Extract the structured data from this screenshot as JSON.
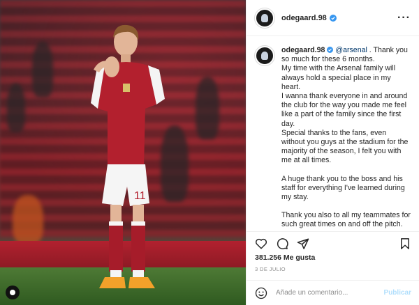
{
  "post": {
    "username": "odegaard.98",
    "likes": "381.256 Me gusta",
    "date": "3 DE JULIO"
  },
  "caption": {
    "username": "odegaard.98",
    "mention": "@arsenal",
    "p1": ". Thank you so much for these 6 months.",
    "p2": "My time with the Arsenal family will always hold a special place in my heart.",
    "p3": "I wanna thank everyone in and around the club for the way you made me feel like a part of the family since the first day.",
    "p4": "Special thanks to the fans, even without you guys at the stadium for the majority of the season, I felt you with me at all times.",
    "p5": "A huge thank you to the boss and his staff for everything I've learned during my stay.",
    "p6": "Thank you also to all my teammates for such great times on and off the pitch."
  },
  "comment": {
    "placeholder": "Añade un comentario...",
    "publish_label": "Publicar"
  },
  "icons": {
    "like": "heart-icon",
    "comment": "comment-icon",
    "share": "paper-plane-icon",
    "save": "bookmark-icon",
    "emoji": "smiley-icon",
    "more": "more-options-icon",
    "verified": "verified-badge-icon"
  },
  "colors": {
    "verified_blue": "#3897f0",
    "mention_blue": "#00376b",
    "publish_disabled": "#b2dffc"
  }
}
